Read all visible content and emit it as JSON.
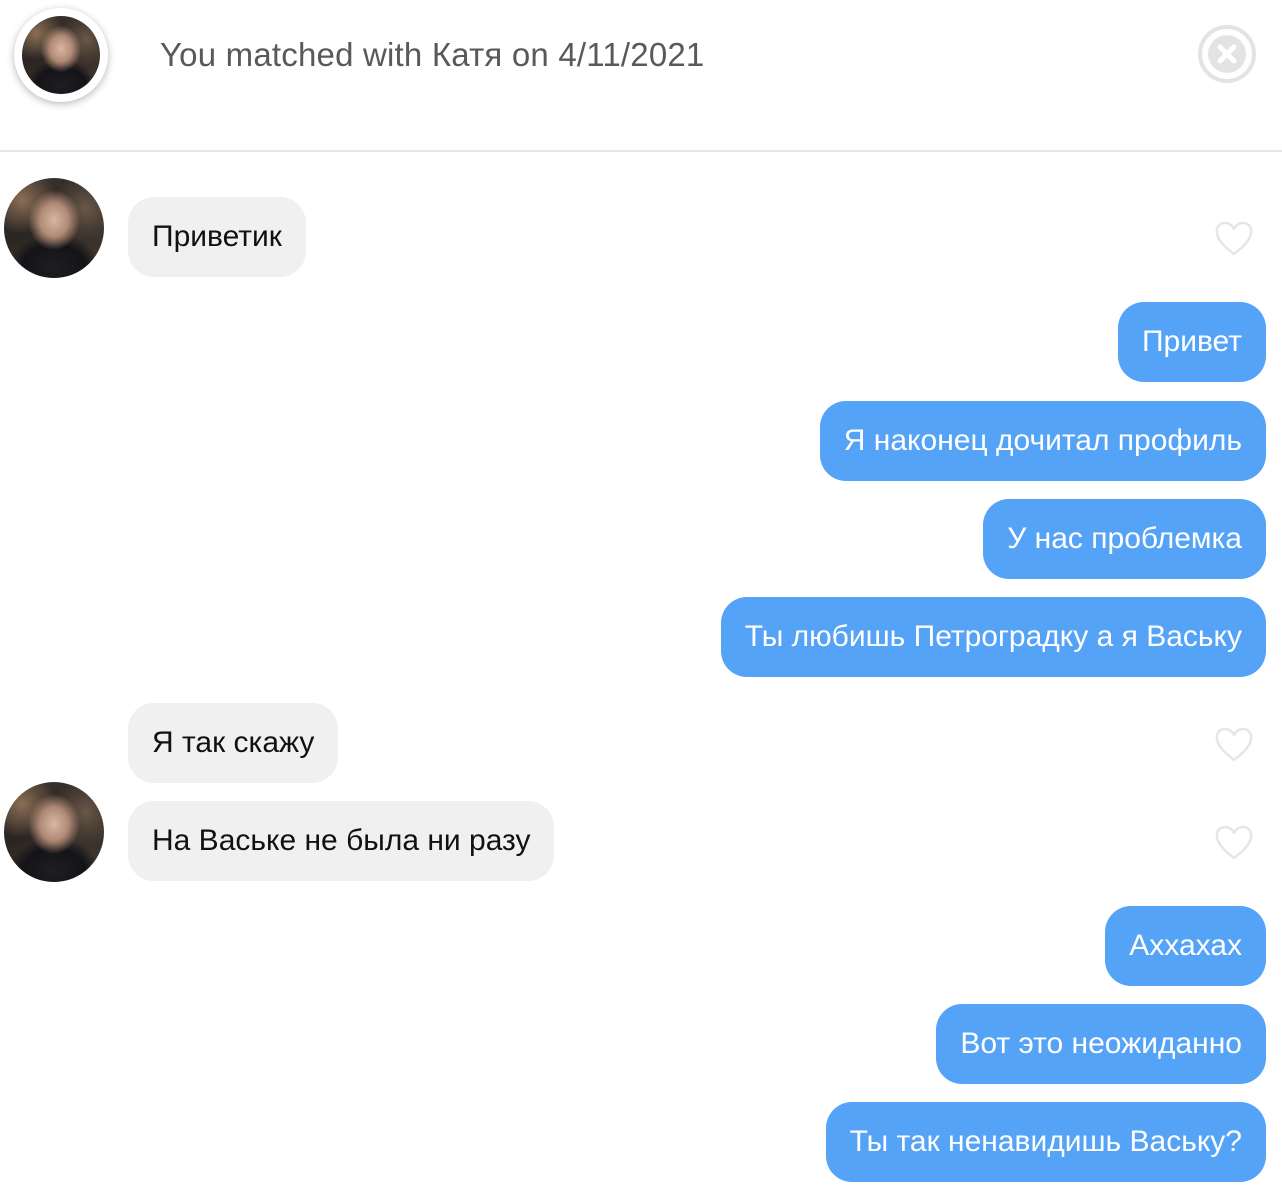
{
  "header": {
    "match_text": "You matched with Катя on 4/11/2021",
    "close_icon": "close-circle-icon",
    "avatar_icon": "profile-photo"
  },
  "colors": {
    "outgoing_bubble": "#55a3f7",
    "incoming_bubble": "#f0f0f0",
    "header_text": "#595959",
    "divider": "#e6e6e6"
  },
  "messages": [
    {
      "direction": "in",
      "text": "Приветик",
      "liked": false,
      "show_avatar": true
    },
    {
      "direction": "out",
      "text": "Привет"
    },
    {
      "direction": "out",
      "text": "Я наконец дочитал профиль"
    },
    {
      "direction": "out",
      "text": "У нас проблемка"
    },
    {
      "direction": "out",
      "text": "Ты любишь Петроградку а я Ваську"
    },
    {
      "direction": "in",
      "text": "Я так скажу",
      "liked": false,
      "show_avatar": false
    },
    {
      "direction": "in",
      "text": "На Ваське не была ни разу",
      "liked": false,
      "show_avatar": true
    },
    {
      "direction": "out",
      "text": "Аххахах"
    },
    {
      "direction": "out",
      "text": "Вот это неожиданно"
    },
    {
      "direction": "out",
      "text": "Ты так ненавидишь Ваську?"
    }
  ]
}
